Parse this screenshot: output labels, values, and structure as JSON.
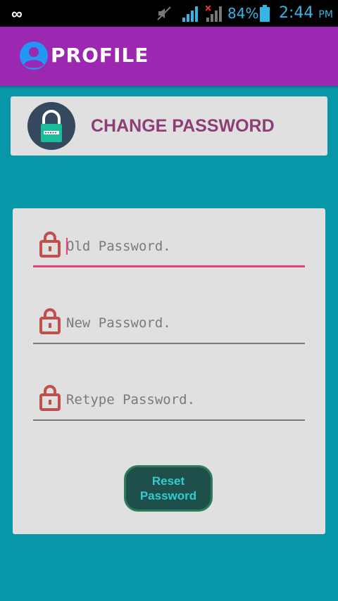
{
  "status_bar": {
    "battery_percent": "84%",
    "time": "2:44",
    "ampm": "PM",
    "icons": [
      "infinity-icon",
      "mute-icon",
      "signal-icon",
      "signal-no-data-icon",
      "battery-icon"
    ]
  },
  "app_bar": {
    "title": "PROFILE",
    "icon": "user-icon",
    "color": "#9c27b0"
  },
  "header": {
    "title": "CHANGE PASSWORD",
    "icon": "lock-icon"
  },
  "form": {
    "old_password": {
      "placeholder": "Old Password."
    },
    "new_password": {
      "placeholder": "New Password."
    },
    "retype_password": {
      "placeholder": "Retype Password."
    },
    "reset_button": "Reset\nPassword"
  },
  "colors": {
    "background": "#0797a8",
    "accent": "#ec407a",
    "title_text": "#8e3e77",
    "lock_icon": "#c0504d"
  }
}
